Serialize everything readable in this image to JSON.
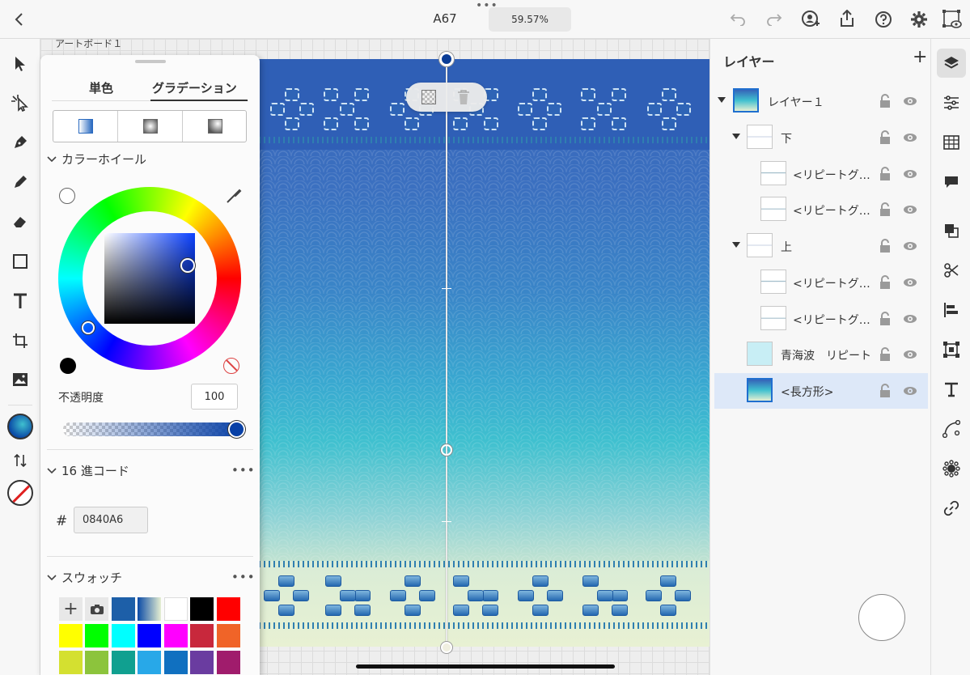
{
  "header": {
    "document_title": "A67",
    "zoom_level": "59.57%"
  },
  "canvas": {
    "artboard_label": "アートボード１"
  },
  "color_panel": {
    "tabs": [
      "単色",
      "グラデーション"
    ],
    "active_tab": "グラデーション",
    "color_wheel_label": "カラーホイール",
    "opacity_label": "不透明度",
    "opacity_value": "100",
    "hex_section_label": "16 進コード",
    "hex_symbol": "#",
    "hex_value": "0840A6",
    "swatches_label": "スウォッチ",
    "swatch_colors": [
      "#1d5fa8",
      "#2a80c8",
      "#ffffff",
      "#000000",
      "#ff0000",
      "#ffff00",
      "#00ff00",
      "#00ffff",
      "#0000ff",
      "#ff00ff",
      "#c8283c",
      "#f06428",
      "#d4e030",
      "#8cc43c",
      "#10a090",
      "#28a8e8",
      "#1070c0",
      "#6a3ca0",
      "#a01c6c"
    ]
  },
  "layers_panel": {
    "title": "レイヤー",
    "items": [
      {
        "label": "レイヤー１"
      },
      {
        "label": "下"
      },
      {
        "label": "<リピートグ…"
      },
      {
        "label": "<リピートグ…"
      },
      {
        "label": "上"
      },
      {
        "label": "<リピートグ…"
      },
      {
        "label": "<リピートグ…"
      },
      {
        "label": "青海波　リピート"
      },
      {
        "label": "<長方形>"
      }
    ],
    "selected_item": "<長方形>"
  },
  "colors": {
    "accent": "#0a4aa6",
    "selected_row": "#dde8f8"
  }
}
